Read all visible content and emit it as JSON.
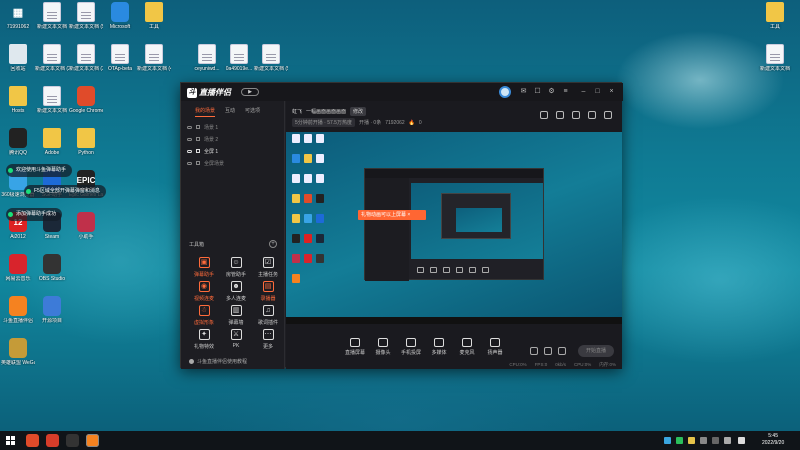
{
  "desktop": {
    "icons_left": [
      {
        "label": "71991062",
        "kind": "text"
      },
      {
        "label": "新建文本文档",
        "kind": "doc"
      },
      {
        "label": "新建文本文档 (5)",
        "kind": "doc"
      },
      {
        "label": "Microsoft",
        "kind": "app",
        "color": "#2a8ae0"
      },
      {
        "label": "工具",
        "kind": "folder"
      },
      {
        "label": "回收站",
        "kind": "bin"
      },
      {
        "label": "新建文本文档 (2)",
        "kind": "doc"
      },
      {
        "label": "新建文本文档 (3)",
        "kind": "doc"
      },
      {
        "label": "OTAp-beta",
        "kind": "doc"
      },
      {
        "label": "新建文本文档 (4)",
        "kind": "doc"
      },
      {
        "label": "Hosts",
        "kind": "folder"
      },
      {
        "label": "新建文本文档",
        "kind": "doc"
      },
      {
        "label": "Google Chrome",
        "kind": "app",
        "color": "#e04b2a"
      },
      {
        "label": "腾讯QQ",
        "kind": "app",
        "color": "#222222"
      },
      {
        "label": "Adobe",
        "kind": "folder"
      },
      {
        "label": "Python",
        "kind": "folder"
      },
      {
        "label": "360极速浏览器",
        "kind": "app",
        "color": "#38a4e6"
      },
      {
        "label": "SGF助手",
        "kind": "app",
        "color": "#1d6ad8"
      },
      {
        "label": "Epic Games Launcher",
        "kind": "app",
        "color": "#222222",
        "glyph": "EPIC"
      },
      {
        "label": "Ai2012",
        "kind": "app",
        "color": "#d22",
        "glyph": "12"
      },
      {
        "label": "Steam",
        "kind": "app",
        "color": "#1b2838"
      },
      {
        "label": "小助手",
        "kind": "app",
        "color": "#c0304a"
      },
      {
        "label": "网易云音乐",
        "kind": "app",
        "color": "#d8242c"
      },
      {
        "label": "OBS Studio",
        "kind": "app",
        "color": "#333333"
      },
      {
        "label": "斗鱼直播伴侣",
        "kind": "app",
        "color": "#f58220"
      },
      {
        "label": "开源项目",
        "kind": "app",
        "color": "#3d7bd8"
      },
      {
        "label": "英雄联盟 WeGame版",
        "kind": "app",
        "color": "#c59b38"
      }
    ],
    "icons_top": [
      {
        "label": "ceyuniwd...",
        "kind": "doc"
      },
      {
        "label": "0a49019e...",
        "kind": "doc"
      },
      {
        "label": "新建文本文档 (5)",
        "kind": "doc"
      }
    ],
    "icons_right": [
      {
        "label": "工具",
        "kind": "folder"
      },
      {
        "label": "新建文本文档",
        "kind": "doc"
      }
    ],
    "toasts": [
      {
        "text": "欢迎使用斗鱼弹幕助手"
      },
      {
        "text": "F5区域全部开弹幕弹窗和消息"
      },
      {
        "text": "添加弹幕助手成功"
      }
    ]
  },
  "app": {
    "title": "直播伴侣",
    "play_label": "▶",
    "sidebar": {
      "tabs": [
        "我的场景",
        "互动",
        "可选项"
      ],
      "scenes": [
        "场景 1",
        "场景 2",
        "全屏 1",
        "全屏场景"
      ],
      "tools_title": "工具箱",
      "tools_add": "+",
      "tools": [
        {
          "label": "弹幕助手",
          "icon": "▣",
          "hot": true
        },
        {
          "label": "房管助手",
          "icon": "☺",
          "hot": false
        },
        {
          "label": "主播任务",
          "icon": "☑",
          "hot": false
        },
        {
          "label": "视频连麦",
          "icon": "◉",
          "hot": true
        },
        {
          "label": "多人连麦",
          "icon": "☻",
          "hot": false
        },
        {
          "label": "录播器",
          "icon": "▤",
          "hot": true
        },
        {
          "label": "虚拟形象",
          "icon": "☃",
          "hot": true
        },
        {
          "label": "弹幕墙",
          "icon": "▥",
          "hot": false
        },
        {
          "label": "歌词插件",
          "icon": "♫",
          "hot": false
        },
        {
          "label": "礼物特效",
          "icon": "✦",
          "hot": false
        },
        {
          "label": "PK",
          "icon": "⚔",
          "hot": false
        },
        {
          "label": "更多",
          "icon": "⋯",
          "hot": false
        }
      ],
      "footer": "斗鱼直播伴侣使用教程"
    },
    "main": {
      "streamer_name": "虹飞",
      "streamer_title": "一幅画面画面画面",
      "streamer_tag": "修改",
      "meta_chip": "5分钟前开播 · 57.5万热度",
      "meta_text1": "开播 · 0条",
      "meta_text2": "7192062",
      "meta_text3": "0",
      "popup_text": "礼物动画可以上屏幕 ×",
      "controls": [
        {
          "label": "直播屏幕"
        },
        {
          "label": "摄像头"
        },
        {
          "label": "手机投屏"
        },
        {
          "label": "多媒体"
        },
        {
          "label": "麦克风"
        },
        {
          "label": "扬声器"
        }
      ],
      "start_label": "开始直播",
      "status": [
        "CPU:0%",
        "FPS:0",
        "0kb/s",
        "CPU:0%",
        "内存:0%"
      ]
    }
  },
  "taskbar": {
    "time": "5:45",
    "date": "2022/9/20",
    "apps": [
      {
        "name": "chrome",
        "color": "#e04b2a"
      },
      {
        "name": "douyu-red",
        "color": "#d63d2a"
      },
      {
        "name": "douyu-dark",
        "color": "#333333"
      },
      {
        "name": "douyu-orange",
        "color": "#f58220"
      }
    ]
  }
}
